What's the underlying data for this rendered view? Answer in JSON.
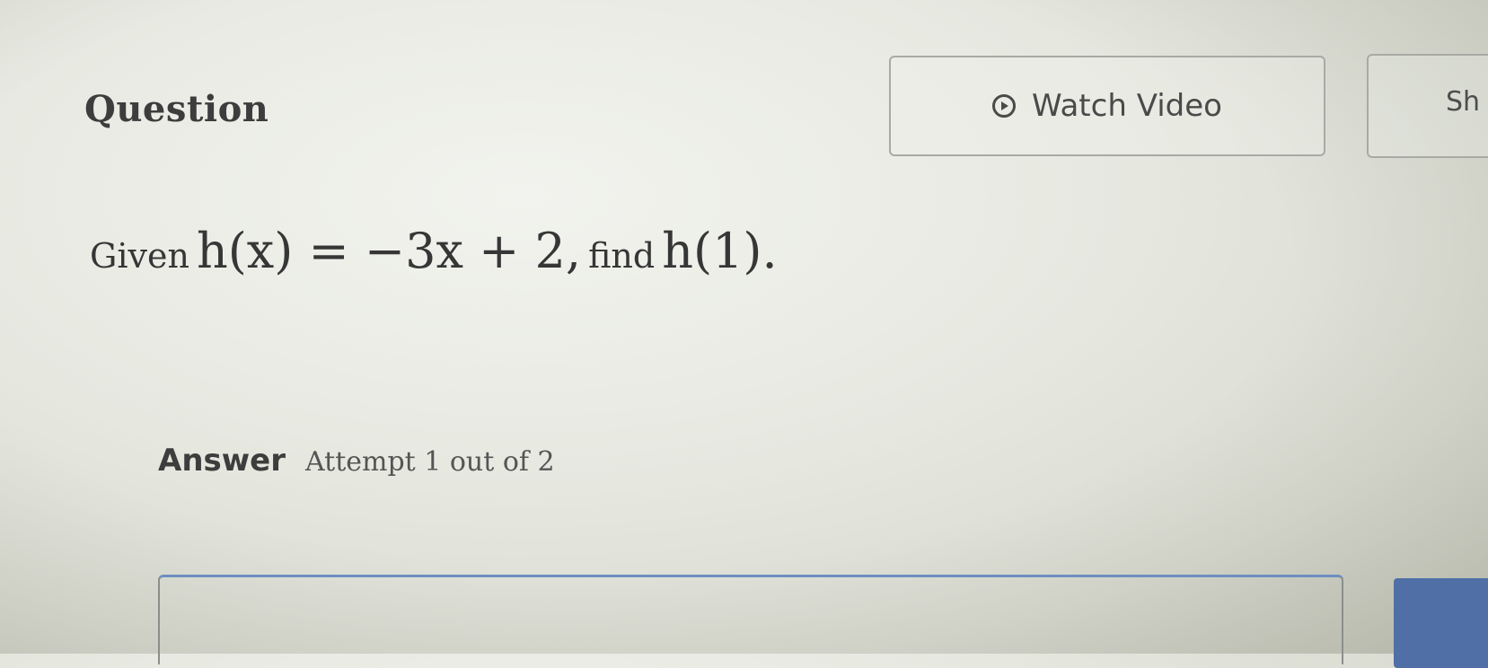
{
  "header": {
    "question_label": "Question",
    "watch_video_label": "Watch Video",
    "show_button_label": "Sh"
  },
  "problem": {
    "prefix": "Given",
    "function_def": "h(x) = −3x + 2,",
    "middle": "find",
    "target": "h(1)."
  },
  "answer": {
    "label": "Answer",
    "attempt": "Attempt 1 out of 2",
    "input_value": ""
  },
  "icons": {
    "watch_video": "play-circle-icon"
  },
  "colors": {
    "input_focus_border": "#6c8fc0",
    "submit_button": "#4f6fa6"
  }
}
